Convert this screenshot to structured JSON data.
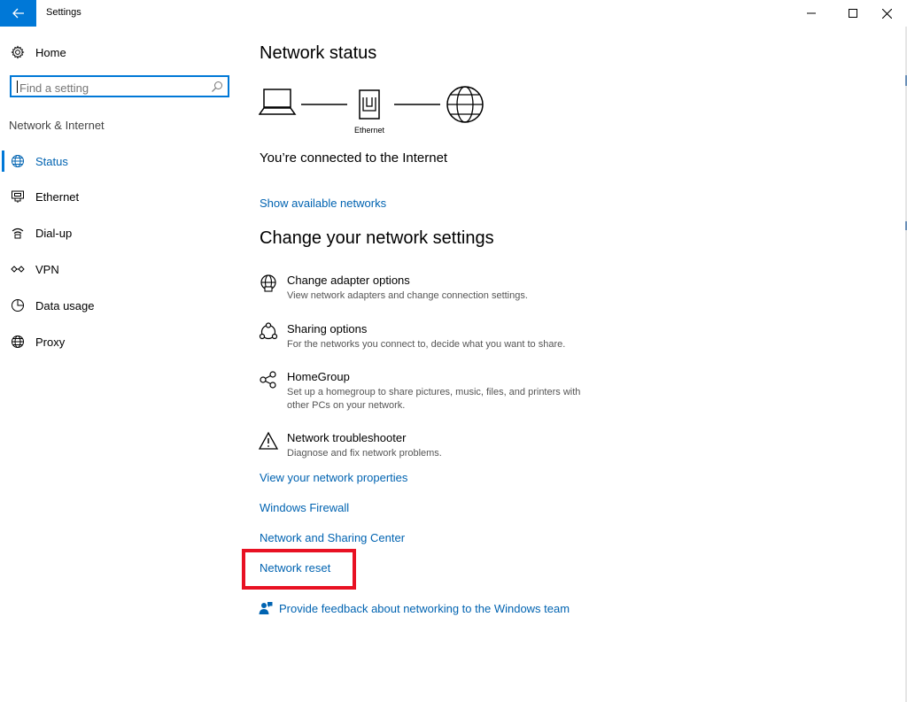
{
  "window": {
    "title": "Settings"
  },
  "sidebar": {
    "home_label": "Home",
    "search_placeholder": "Find a setting",
    "section_label": "Network & Internet",
    "items": [
      {
        "label": "Status",
        "icon": "globe-icon",
        "active": true
      },
      {
        "label": "Ethernet",
        "icon": "ethernet-icon",
        "active": false
      },
      {
        "label": "Dial-up",
        "icon": "dialup-icon",
        "active": false
      },
      {
        "label": "VPN",
        "icon": "vpn-icon",
        "active": false
      },
      {
        "label": "Data usage",
        "icon": "data-usage-icon",
        "active": false
      },
      {
        "label": "Proxy",
        "icon": "globe-icon",
        "active": false
      }
    ]
  },
  "main": {
    "network_status_heading": "Network status",
    "diagram_label": "Ethernet",
    "connected_text": "You’re connected to the Internet",
    "show_networks_link": "Show available networks",
    "change_heading": "Change your network settings",
    "settings": [
      {
        "title": "Change adapter options",
        "desc": "View network adapters and change connection settings.",
        "icon": "adapter-globe-icon"
      },
      {
        "title": "Sharing options",
        "desc": "For the networks you connect to, decide what you want to share.",
        "icon": "sharing-icon"
      },
      {
        "title": "HomeGroup",
        "desc": "Set up a homegroup to share pictures, music, files, and printers with other PCs on your network.",
        "icon": "homegroup-icon"
      },
      {
        "title": "Network troubleshooter",
        "desc": "Diagnose and fix network problems.",
        "icon": "warning-icon"
      }
    ],
    "links": {
      "properties": "View your network properties",
      "firewall": "Windows Firewall",
      "sharing_center": "Network and Sharing Center",
      "reset": "Network reset"
    },
    "feedback_label": "Provide feedback about networking to the Windows team"
  },
  "colors": {
    "accent": "#0078d7",
    "link": "#0063b1",
    "highlight": "#e81123"
  }
}
